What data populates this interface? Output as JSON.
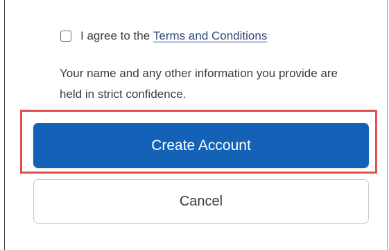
{
  "agreement": {
    "checked": false,
    "prefix_text": "I agree to the ",
    "link_text": "Terms and Conditions"
  },
  "notice": {
    "text": "Your name and any other information you provide are held in strict confidence."
  },
  "actions": {
    "create_label": "Create Account",
    "cancel_label": "Cancel"
  },
  "colors": {
    "primary": "#1462b8",
    "highlight": "#e0504e",
    "link": "#2f4a7a"
  }
}
